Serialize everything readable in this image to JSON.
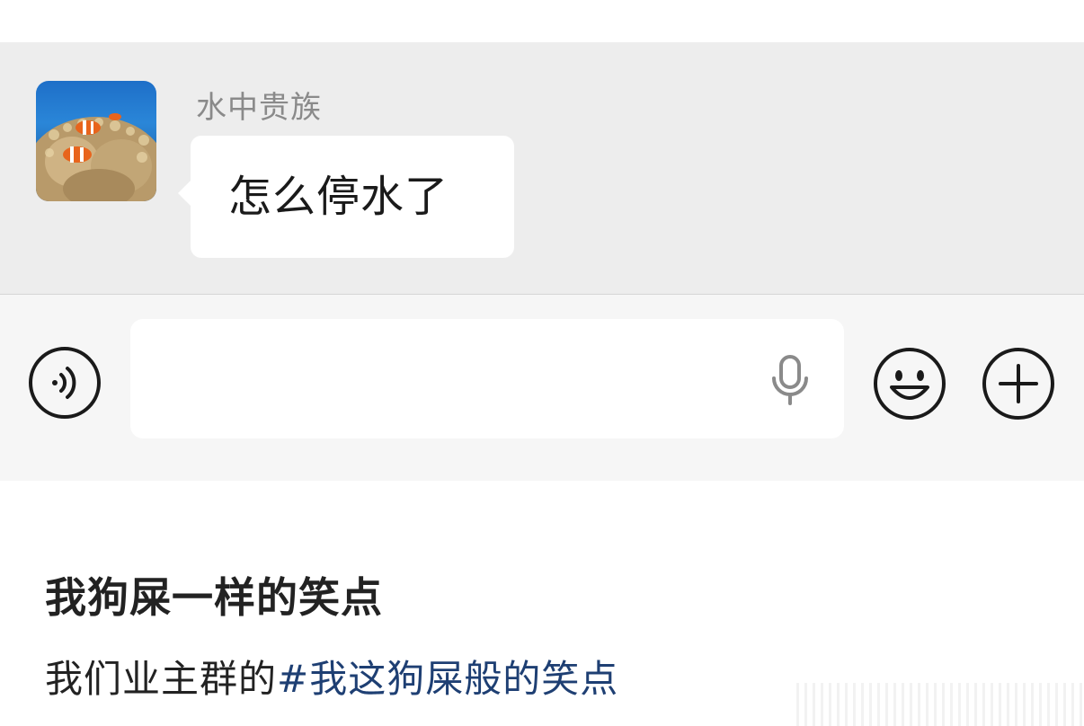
{
  "chat": {
    "sender_name": "水中贵族",
    "message": "怎么停水了",
    "avatar_icon": "clownfish-anemone-avatar"
  },
  "input_bar": {
    "text_value": "",
    "placeholder": "",
    "voice_icon": "voice-mode-icon",
    "mic_icon": "microphone-icon",
    "emoji_icon": "smiley-face-icon",
    "plus_icon": "plus-circle-icon"
  },
  "post": {
    "title": "我狗屎一样的笑点",
    "body_prefix": "我们业主群的",
    "hashtag": "#我这狗屎般的笑点"
  },
  "colors": {
    "chat_background": "#ededed",
    "bubble": "#ffffff",
    "input_bar": "#f6f6f6",
    "hashtag": "#1e3f73",
    "sender_name": "#8a8a8a"
  }
}
